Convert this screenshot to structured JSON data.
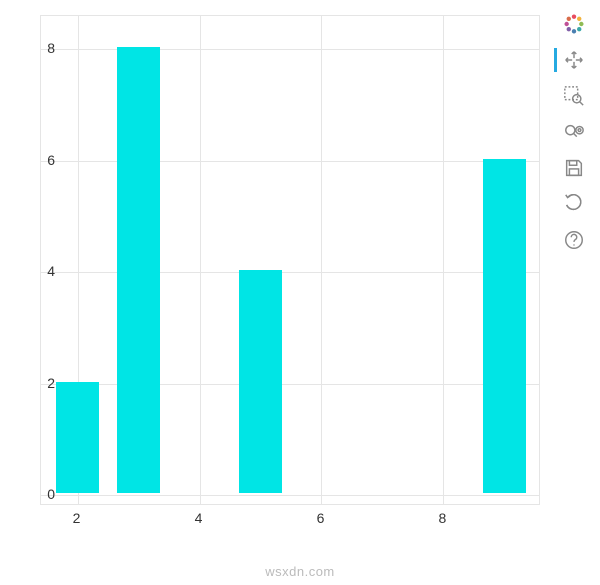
{
  "chart_data": {
    "type": "bar",
    "x": [
      2,
      3,
      5,
      9
    ],
    "values": [
      2,
      8,
      4,
      6
    ],
    "bar_width": 0.7,
    "xlim": [
      1.4,
      9.6
    ],
    "ylim": [
      -0.2,
      8.6
    ],
    "x_ticks": [
      2,
      4,
      6,
      8
    ],
    "y_ticks": [
      0,
      2,
      4,
      6,
      8
    ],
    "bar_color": "#00e5e5",
    "title": "",
    "xlabel": "",
    "ylabel": ""
  },
  "toolbar": {
    "logo_label": "Bokeh",
    "pan_label": "Pan",
    "box_zoom_label": "Box Zoom",
    "wheel_zoom_label": "Wheel Zoom",
    "save_label": "Save",
    "reset_label": "Reset",
    "help_label": "Help",
    "active_tool": "pan"
  },
  "watermark": "wsxdn.com"
}
